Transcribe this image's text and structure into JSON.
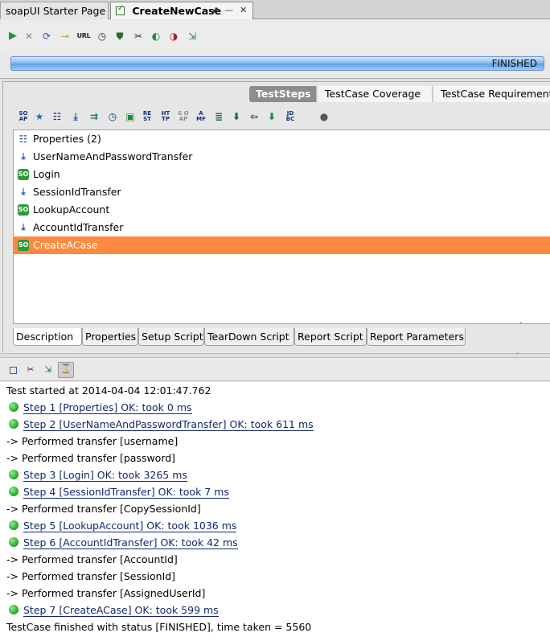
{
  "tabs": [
    {
      "label": "soapUI Starter Page",
      "active": false
    },
    {
      "label": "CreateNewCase",
      "active": true
    }
  ],
  "tab_controls": {
    "undock": "⬈",
    "minimize": "—",
    "close": "✕"
  },
  "toolbar": {
    "run_glyph": "▶",
    "cancel_glyph": "✕",
    "loop_glyph": "⟳",
    "credentials_glyph": "⊸",
    "url_label": "URL",
    "timer_glyph": "◷",
    "security_glyph": "⛊",
    "options_glyph": "✂",
    "loadtest_glyph": "◐",
    "securitytest_glyph": "◑",
    "export_glyph": "⇲"
  },
  "progress": {
    "status": "FINISHED",
    "fraction": 1.0
  },
  "right_tabs": [
    "TestSteps",
    "TestCase Coverage",
    "TestCase Requirement"
  ],
  "step_strip": [
    "SO AP",
    "★",
    "☷",
    "⤓",
    "⇉",
    "◷",
    "▣",
    "RE ST",
    "HT TP",
    "S O AP",
    "A MF",
    "≣",
    "⬇",
    "⇦",
    "⬇",
    "JD BC",
    "●"
  ],
  "steps": [
    {
      "label": "Properties (2)",
      "icon": "properties-icon",
      "glyph": "☷",
      "selected": false
    },
    {
      "label": "UserNameAndPasswordTransfer",
      "icon": "property-transfer-icon",
      "glyph": "⤓",
      "selected": false
    },
    {
      "label": "Login",
      "icon": "soap-request-icon",
      "glyph": "SO",
      "selected": false
    },
    {
      "label": "SessionIdTransfer",
      "icon": "property-transfer-icon",
      "glyph": "⤓",
      "selected": false
    },
    {
      "label": "LookupAccount",
      "icon": "soap-request-icon",
      "glyph": "SO",
      "selected": false
    },
    {
      "label": "AccountIdTransfer",
      "icon": "property-transfer-icon",
      "glyph": "⤓",
      "selected": false
    },
    {
      "label": "CreateACase",
      "icon": "soap-request-icon",
      "glyph": "SO",
      "selected": true
    }
  ],
  "bottom_tabs": [
    "Description",
    "Properties",
    "Setup Script",
    "TearDown Script",
    "Report Script",
    "Report Parameters"
  ],
  "log_toolbar": {
    "clear_glyph": "",
    "options_glyph": "✂",
    "export_glyph": "⇲",
    "hourglass_glyph": "⌛"
  },
  "log": [
    {
      "text": "Test started at 2014-04-04 12:01:47.762",
      "kind": "plain"
    },
    {
      "text": "Step 1 [Properties] OK: took 0 ms",
      "kind": "step"
    },
    {
      "text": "Step 2 [UserNameAndPasswordTransfer] OK: took 611 ms",
      "kind": "step"
    },
    {
      "text": "-> Performed transfer [username]",
      "kind": "plain"
    },
    {
      "text": "-> Performed transfer [password]",
      "kind": "plain"
    },
    {
      "text": "Step 3 [Login] OK: took 3265 ms",
      "kind": "step"
    },
    {
      "text": "Step 4 [SessionIdTransfer] OK: took 7 ms",
      "kind": "step"
    },
    {
      "text": "-> Performed transfer [CopySessionId]",
      "kind": "plain"
    },
    {
      "text": "Step 5 [LookupAccount] OK: took 1036 ms",
      "kind": "step"
    },
    {
      "text": "Step 6 [AccountIdTransfer] OK: took 42 ms",
      "kind": "step"
    },
    {
      "text": "-> Performed transfer [AccountId]",
      "kind": "plain"
    },
    {
      "text": "-> Performed transfer [SessionId]",
      "kind": "plain"
    },
    {
      "text": "-> Performed transfer [AssignedUserId]",
      "kind": "plain"
    },
    {
      "text": "Step 7 [CreateACase] OK: took 599 ms",
      "kind": "step"
    },
    {
      "text": "TestCase finished with status [FINISHED], time taken = 5560",
      "kind": "plain"
    }
  ],
  "colors": {
    "selection": "#fd8a3f",
    "progress": "#5d9ee6",
    "ok": "#1fa21f",
    "link": "#14276e"
  }
}
